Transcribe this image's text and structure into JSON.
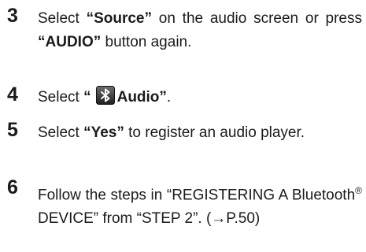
{
  "steps": [
    {
      "number": "3",
      "pre": "Select ",
      "q1": "“Source”",
      "mid": " on the audio screen or press ",
      "q2": "“AUDIO”",
      "post": " button again."
    },
    {
      "number": "4",
      "pre": "Select ",
      "q_open": "“",
      "icon": "bluetooth-icon",
      "label": "Audio”",
      "post": "."
    },
    {
      "number": "5",
      "pre": "Select ",
      "q1": "“Yes”",
      "post": " to register an audio player."
    },
    {
      "number": "6",
      "pre": "Follow the steps in “REGISTERING A Bluetooth",
      "sup": "®",
      "post": " DEVICE” from “STEP 2”. (→P.50)"
    }
  ]
}
